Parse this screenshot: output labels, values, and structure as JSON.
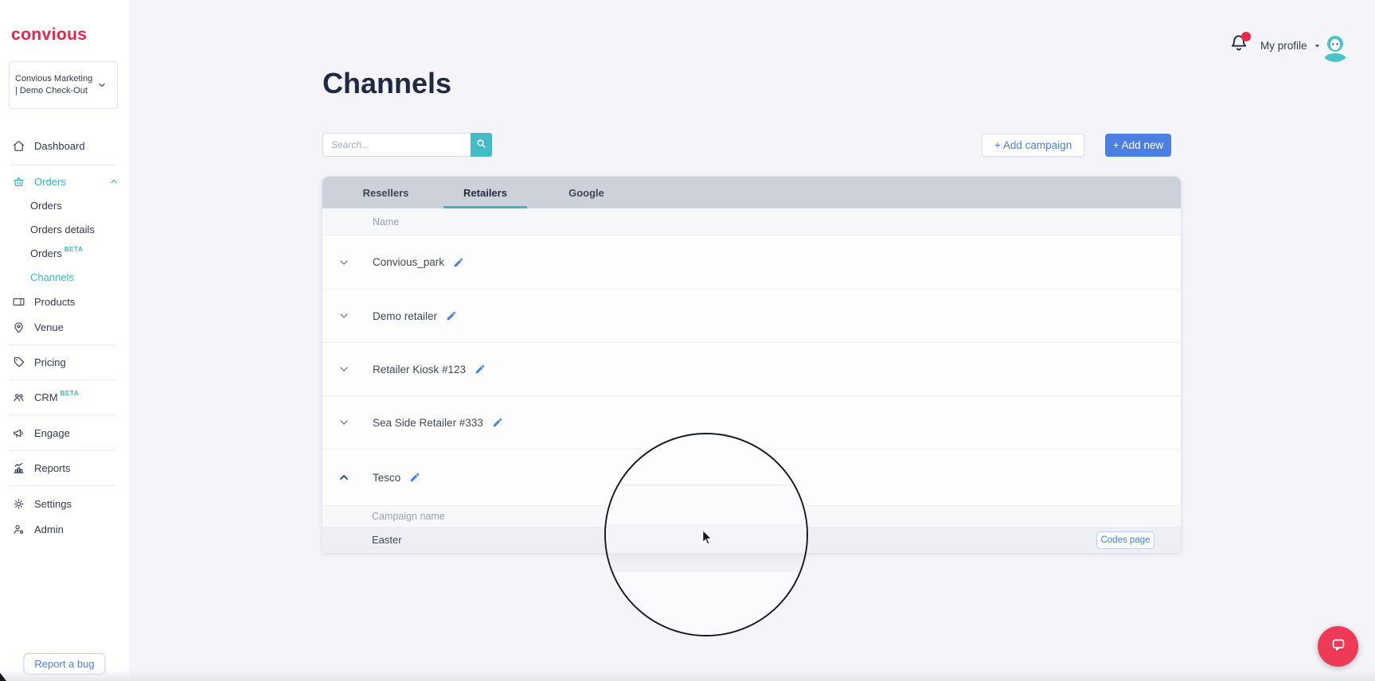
{
  "brand": {
    "logo_text": "convious"
  },
  "topbar": {
    "profile_label": "My profile"
  },
  "sidebar": {
    "workspace_label": "Convious Marketing | Demo Check-Out",
    "items": [
      {
        "label": "Dashboard"
      },
      {
        "label": "Orders"
      },
      {
        "label": "Orders"
      },
      {
        "label": "Orders details"
      },
      {
        "label": "Orders",
        "beta": "BETA"
      },
      {
        "label": "Channels"
      },
      {
        "label": "Products"
      },
      {
        "label": "Venue"
      },
      {
        "label": "Pricing"
      },
      {
        "label": "CRM",
        "beta": "BETA"
      },
      {
        "label": "Engage"
      },
      {
        "label": "Reports"
      },
      {
        "label": "Settings"
      },
      {
        "label": "Admin"
      }
    ],
    "report_bug_label": "Report a bug"
  },
  "page": {
    "title": "Channels",
    "search_placeholder": "Search...",
    "add_campaign_label": "+ Add campaign",
    "add_new_label": "+ Add new"
  },
  "tabs": [
    {
      "label": "Resellers",
      "active": false
    },
    {
      "label": "Retailers",
      "active": true
    },
    {
      "label": "Google",
      "active": false
    }
  ],
  "table": {
    "name_header": "Name",
    "rows": [
      {
        "name": "Convious_park",
        "expanded": false
      },
      {
        "name": "Demo retailer",
        "expanded": false
      },
      {
        "name": "Retailer Kiosk #123",
        "expanded": false
      },
      {
        "name": "Sea Side Retailer #333",
        "expanded": false
      },
      {
        "name": "Tesco",
        "expanded": true
      }
    ],
    "campaigns_header": "Campaign name",
    "campaigns": [
      {
        "name": "Easter",
        "action_label": "Codes page"
      }
    ]
  },
  "colors": {
    "brand_red": "#e8244d",
    "teal_accent": "#3db6c1",
    "action_blue": "#4a7fe4",
    "tab_bar_grey": "#ccd1da",
    "chat_red": "#ed3a57"
  }
}
